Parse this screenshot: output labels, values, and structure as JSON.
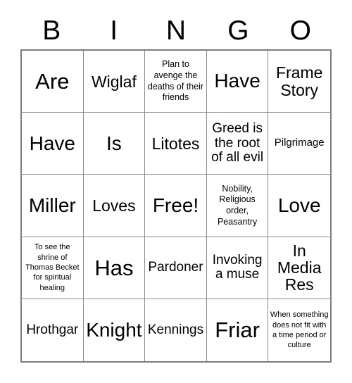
{
  "header": {
    "letters": [
      "B",
      "I",
      "N",
      "G",
      "O"
    ]
  },
  "grid": {
    "rows": 5,
    "columns": 5,
    "border_color": "#7d7d7d",
    "line_color": "#8a8a8a",
    "background": "#ffffff",
    "text_color": "#000000",
    "cells": [
      {
        "text": "Are",
        "size": "fs-xl"
      },
      {
        "text": "Wiglaf",
        "size": "fs-md"
      },
      {
        "text": "Plan to avenge the deaths of their friends",
        "size": "fs-xxs"
      },
      {
        "text": "Have",
        "size": "fs-lg"
      },
      {
        "text": "Frame Story",
        "size": "fs-md"
      },
      {
        "text": "Have",
        "size": "fs-lg"
      },
      {
        "text": "Is",
        "size": "fs-lg"
      },
      {
        "text": "Litotes",
        "size": "fs-md"
      },
      {
        "text": "Greed is the root of all evil",
        "size": "fs-sm"
      },
      {
        "text": "Pilgrimage",
        "size": "fs-xs"
      },
      {
        "text": "Miller",
        "size": "fs-lg"
      },
      {
        "text": "Loves",
        "size": "fs-md"
      },
      {
        "text": "Free!",
        "size": "fs-lg"
      },
      {
        "text": "Nobility, Religious order, Peasantry",
        "size": "fs-xxs"
      },
      {
        "text": "Love",
        "size": "fs-lg"
      },
      {
        "text": "To see the shrine of Thomas Becket for spiritual healing",
        "size": "fs-tiny"
      },
      {
        "text": "Has",
        "size": "fs-xl"
      },
      {
        "text": "Pardoner",
        "size": "fs-sm"
      },
      {
        "text": "Invoking a muse",
        "size": "fs-sm"
      },
      {
        "text": "In Media Res",
        "size": "fs-md"
      },
      {
        "text": "Hrothgar",
        "size": "fs-sm"
      },
      {
        "text": "Knight",
        "size": "fs-lg"
      },
      {
        "text": "Kennings",
        "size": "fs-sm"
      },
      {
        "text": "Friar",
        "size": "fs-xl"
      },
      {
        "text": "When something does not fit with a time period or culture",
        "size": "fs-tiny"
      }
    ]
  }
}
